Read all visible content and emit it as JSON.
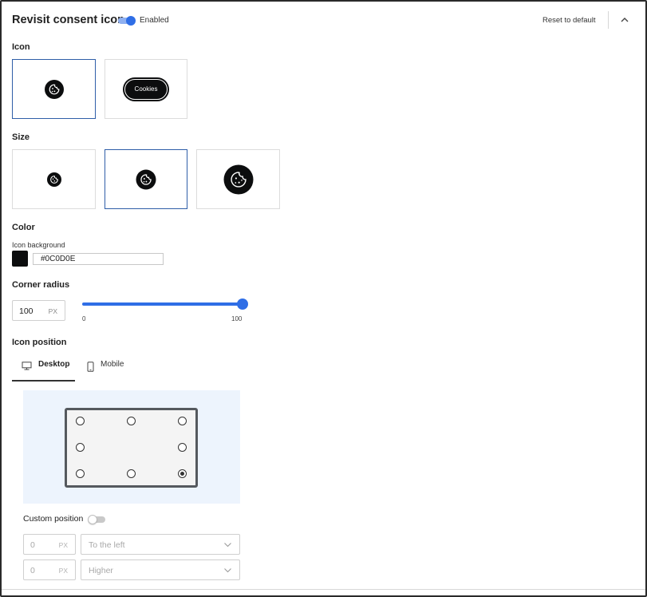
{
  "header": {
    "title": "Revisit consent icon",
    "enabled_label": "Enabled",
    "enabled": true,
    "reset_label": "Reset to default"
  },
  "icon_section": {
    "label": "Icon",
    "options": [
      {
        "id": "cookie-icon",
        "selected": true
      },
      {
        "id": "cookies-pill",
        "text": "Cookies",
        "selected": false
      }
    ]
  },
  "size_section": {
    "label": "Size",
    "options": [
      {
        "id": "small",
        "selected": false
      },
      {
        "id": "medium",
        "selected": true
      },
      {
        "id": "large",
        "selected": false
      }
    ]
  },
  "color_section": {
    "label": "Color",
    "background_label": "Icon background",
    "background_value": "#0C0D0E",
    "swatch_color": "#0C0D0E"
  },
  "corner_radius": {
    "label": "Corner radius",
    "value": "100",
    "unit": "PX",
    "slider_min": "0",
    "slider_max": "100",
    "slider_value": 100
  },
  "icon_position": {
    "label": "Icon position",
    "tabs": [
      {
        "label": "Desktop",
        "icon": "desktop-icon",
        "active": true
      },
      {
        "label": "Mobile",
        "icon": "mobile-icon",
        "active": false
      }
    ],
    "grid_selected": "bottom-right",
    "custom_position_label": "Custom position",
    "custom_position_enabled": false,
    "horizontal": {
      "value": "0",
      "unit": "PX",
      "direction": "To the left"
    },
    "vertical": {
      "value": "0",
      "unit": "PX",
      "direction": "Higher"
    }
  },
  "colors": {
    "accent": "#2F6EE6",
    "selected_border": "#2F5EA8",
    "panel_bg": "#EDF4FD"
  }
}
